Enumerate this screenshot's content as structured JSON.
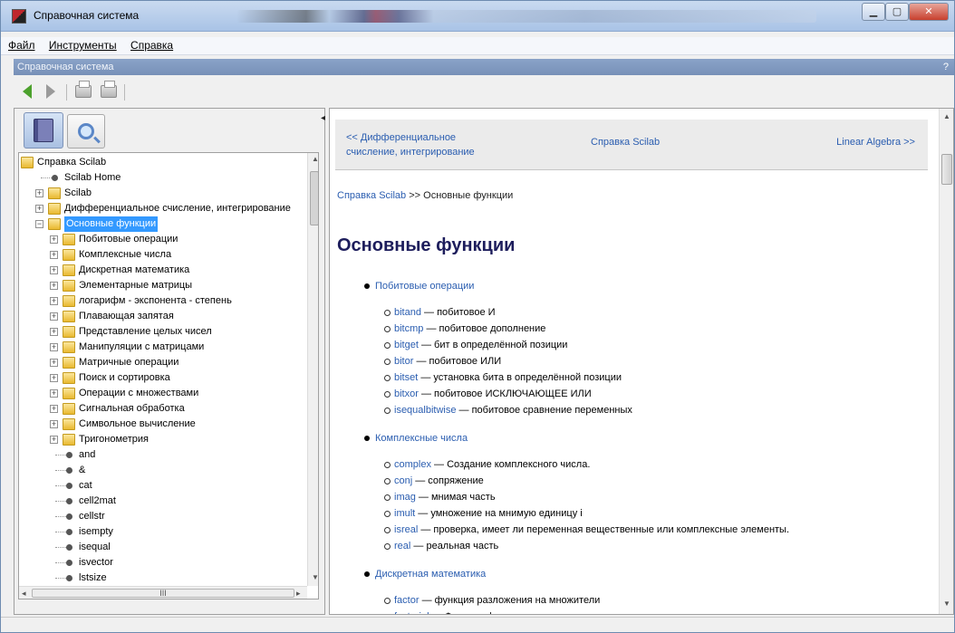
{
  "window": {
    "title": "Справочная система"
  },
  "menu": [
    {
      "label": "Файл"
    },
    {
      "label": "Инструменты"
    },
    {
      "label": "Справка"
    }
  ],
  "help_strip": {
    "title": "Справочная система",
    "help_glyph": "?"
  },
  "toolbar": {
    "icons": [
      "back-arrow-icon",
      "forward-arrow-icon",
      "print-icon",
      "page-setup-icon"
    ],
    "back_color": "#4ca12d"
  },
  "left_tabs": {
    "icons": [
      "book-icon",
      "search-icon"
    ]
  },
  "tree": [
    {
      "label": "Справка Scilab",
      "kind": "folder",
      "depth": 0,
      "expander": ""
    },
    {
      "label": "Scilab Home",
      "kind": "leaf",
      "depth": 1,
      "expander": ""
    },
    {
      "label": "Scilab",
      "kind": "folder",
      "depth": 1,
      "expander": "+"
    },
    {
      "label": "Дифференциальное счисление, интегрирование",
      "kind": "folder",
      "depth": 1,
      "expander": "+"
    },
    {
      "label": "Основные функции",
      "kind": "folder",
      "depth": 1,
      "expander": "−",
      "selected": true
    },
    {
      "label": "Побитовые операции",
      "kind": "folder",
      "depth": 2,
      "expander": "+"
    },
    {
      "label": "Комплексные числа",
      "kind": "folder",
      "depth": 2,
      "expander": "+"
    },
    {
      "label": "Дискретная математика",
      "kind": "folder",
      "depth": 2,
      "expander": "+"
    },
    {
      "label": "Элементарные матрицы",
      "kind": "folder",
      "depth": 2,
      "expander": "+"
    },
    {
      "label": "логарифм - экспонента - степень",
      "kind": "folder",
      "depth": 2,
      "expander": "+"
    },
    {
      "label": "Плавающая запятая",
      "kind": "folder",
      "depth": 2,
      "expander": "+"
    },
    {
      "label": "Представление целых чисел",
      "kind": "folder",
      "depth": 2,
      "expander": "+"
    },
    {
      "label": "Манипуляции с матрицами",
      "kind": "folder",
      "depth": 2,
      "expander": "+"
    },
    {
      "label": "Матричные операции",
      "kind": "folder",
      "depth": 2,
      "expander": "+"
    },
    {
      "label": "Поиск и сортировка",
      "kind": "folder",
      "depth": 2,
      "expander": "+"
    },
    {
      "label": "Операции с множествами",
      "kind": "folder",
      "depth": 2,
      "expander": "+"
    },
    {
      "label": "Сигнальная обработка",
      "kind": "folder",
      "depth": 2,
      "expander": "+"
    },
    {
      "label": "Символьное вычисление",
      "kind": "folder",
      "depth": 2,
      "expander": "+"
    },
    {
      "label": "Тригонометрия",
      "kind": "folder",
      "depth": 2,
      "expander": "+"
    },
    {
      "label": "and",
      "kind": "leaf",
      "depth": 2,
      "expander": ""
    },
    {
      "label": "&",
      "kind": "leaf",
      "depth": 2,
      "expander": ""
    },
    {
      "label": "cat",
      "kind": "leaf",
      "depth": 2,
      "expander": ""
    },
    {
      "label": "cell2mat",
      "kind": "leaf",
      "depth": 2,
      "expander": ""
    },
    {
      "label": "cellstr",
      "kind": "leaf",
      "depth": 2,
      "expander": ""
    },
    {
      "label": "isempty",
      "kind": "leaf",
      "depth": 2,
      "expander": ""
    },
    {
      "label": "isequal",
      "kind": "leaf",
      "depth": 2,
      "expander": ""
    },
    {
      "label": "isvector",
      "kind": "leaf",
      "depth": 2,
      "expander": ""
    },
    {
      "label": "lstsize",
      "kind": "leaf",
      "depth": 2,
      "expander": ""
    }
  ],
  "tree_hscroll_grip": "III",
  "nav": {
    "prev_line1": "<< Дифференциальное",
    "prev_line2": "счисление, интегрирование",
    "top": "Справка Scilab",
    "next": "Linear Algebra >>"
  },
  "breadcrumb": {
    "link": "Справка Scilab",
    "rest": " >> Основные функции"
  },
  "page_title": "Основные функции",
  "sections": [
    {
      "title": "Побитовые операции",
      "items": [
        {
          "fn": "bitand",
          "desc": " — побитовое И"
        },
        {
          "fn": "bitcmp",
          "desc": " — побитовое дополнение"
        },
        {
          "fn": "bitget",
          "desc": " — бит в определённой позиции"
        },
        {
          "fn": "bitor",
          "desc": " — побитовое ИЛИ"
        },
        {
          "fn": "bitset",
          "desc": " — установка бита в определённой позиции"
        },
        {
          "fn": "bitxor",
          "desc": " — побитовое ИСКЛЮЧАЮЩЕЕ ИЛИ"
        },
        {
          "fn": "isequalbitwise",
          "desc": " — побитовое сравнение переменных"
        }
      ]
    },
    {
      "title": "Комплексные числа",
      "items": [
        {
          "fn": "complex",
          "desc": " — Создание комплексного числа."
        },
        {
          "fn": "conj",
          "desc": " — сопряжение"
        },
        {
          "fn": "imag",
          "desc": " — мнимая часть"
        },
        {
          "fn": "imult",
          "desc": " — умножение на мнимую единицу i"
        },
        {
          "fn": "isreal",
          "desc": " — проверка, имеет ли переменная вещественные или комплексные элементы."
        },
        {
          "fn": "real",
          "desc": " — реальная часть"
        }
      ]
    },
    {
      "title": "Дискретная математика",
      "items": [
        {
          "fn": "factor",
          "desc": " — функция разложения на множители"
        },
        {
          "fn": "factorial",
          "desc": " — Функция факториал"
        }
      ]
    }
  ],
  "colors": {
    "link": "#2a5db0",
    "title": "#1d1d5c",
    "selection": "#3399ff"
  }
}
